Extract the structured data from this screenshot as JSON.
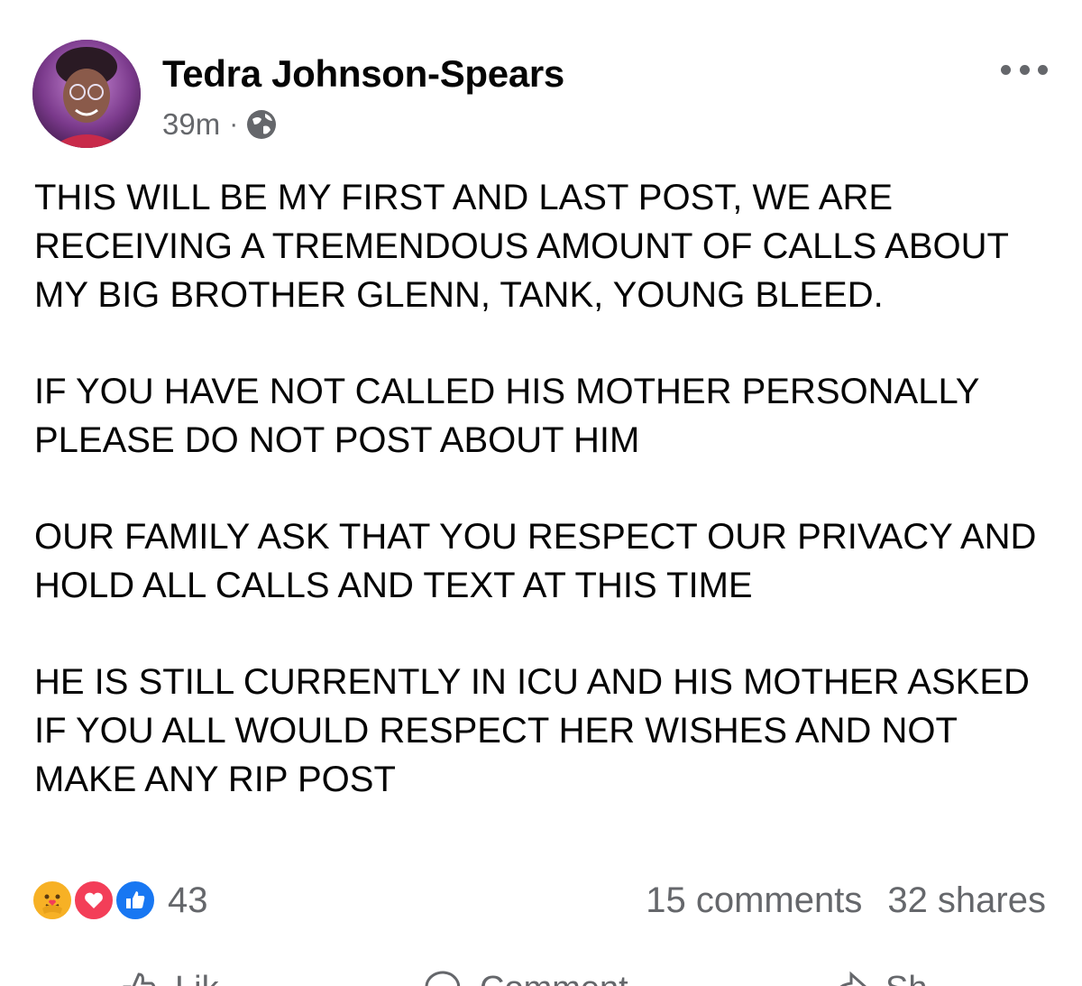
{
  "post": {
    "author": "Tedra Johnson-Spears",
    "timestamp": "39m",
    "separator": "·",
    "visibility_icon": "globe-icon",
    "more_icon": "more-options-icon",
    "paragraphs": [
      "THIS WILL BE MY FIRST AND LAST POST, WE ARE RECEIVING A TREMENDOUS AMOUNT OF CALLS ABOUT MY BIG BROTHER GLENN, TANK, YOUNG BLEED.",
      "IF YOU HAVE NOT CALLED HIS MOTHER PERSONALLY PLEASE DO NOT POST ABOUT HIM",
      "OUR FAMILY ASK THAT YOU RESPECT OUR PRIVACY AND HOLD ALL CALLS AND TEXT AT THIS TIME",
      "HE IS STILL CURRENTLY IN ICU AND HIS MOTHER ASKED IF YOU ALL WOULD RESPECT HER WISHES AND NOT MAKE ANY RIP POST"
    ]
  },
  "engagement": {
    "reaction_icons": [
      "care-reaction-icon",
      "love-reaction-icon",
      "like-reaction-icon"
    ],
    "reaction_count": "43",
    "comments": "15 comments",
    "shares": "32 shares"
  },
  "actions": {
    "like_label": "Lik",
    "comment_label": "Comment",
    "share_label": "Sh"
  },
  "colors": {
    "like_blue": "#1877f2",
    "love_red": "#f33e58",
    "care_yellow": "#f7b125",
    "secondary_text": "#65676b"
  }
}
